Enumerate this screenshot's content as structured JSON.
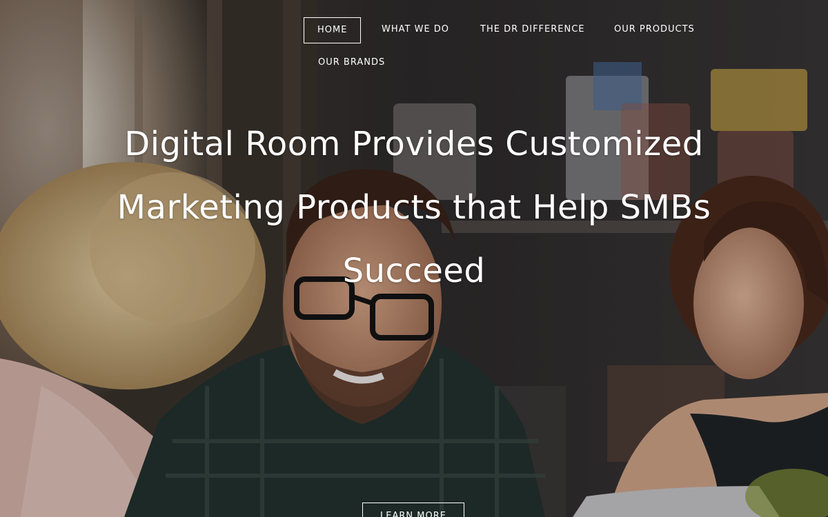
{
  "nav": {
    "items": [
      {
        "label": "HOME"
      },
      {
        "label": "WHAT WE DO"
      },
      {
        "label": "THE DR DIFFERENCE"
      },
      {
        "label": "OUR PRODUCTS"
      },
      {
        "label": "OUR BRANDS"
      }
    ]
  },
  "hero": {
    "headline": "Digital Room Provides Customized Marketing Products that Help SMBs Succeed",
    "cta_label": "LEARN MORE"
  },
  "colors": {
    "text": "#ffffff",
    "background_dark": "#2a2622"
  }
}
